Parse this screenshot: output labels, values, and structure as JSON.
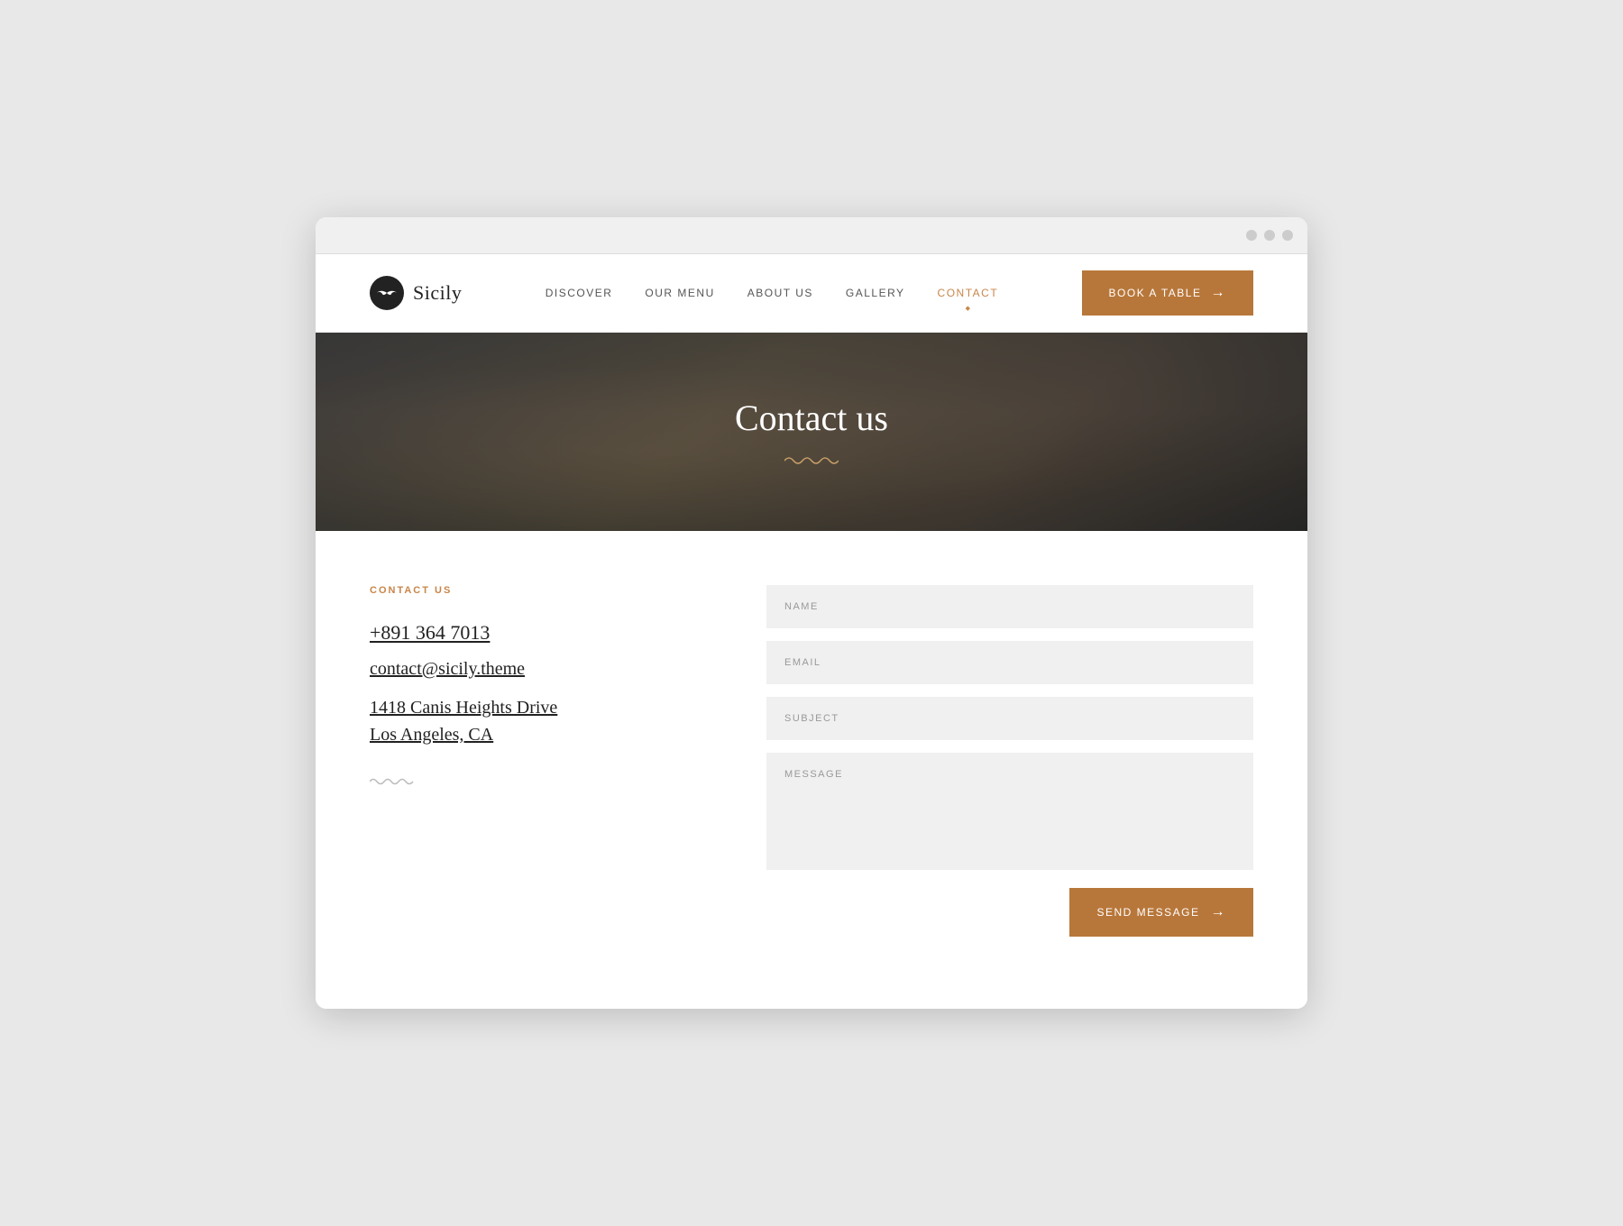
{
  "browser": {
    "dots": [
      "dot1",
      "dot2",
      "dot3"
    ]
  },
  "logo": {
    "text": "Sicily",
    "icon_alt": "mustache-icon"
  },
  "nav": {
    "links": [
      {
        "label": "DISCOVER",
        "active": false
      },
      {
        "label": "OUR MENU",
        "active": false
      },
      {
        "label": "ABOUT US",
        "active": false
      },
      {
        "label": "GALLERY",
        "active": false
      },
      {
        "label": "CONTACT",
        "active": true
      }
    ],
    "book_btn": "BOOK A TABLE",
    "book_arrow": "→"
  },
  "hero": {
    "title": "Contact us",
    "wave_alt": "wave-decoration"
  },
  "contact_info": {
    "label": "CONTACT US",
    "phone": "+891 364 7013",
    "email": "contact@sicily.theme",
    "address_line1": "1418  Canis Heights Drive",
    "address_line2": "Los Angeles, CA"
  },
  "form": {
    "name_placeholder": "NAME",
    "email_placeholder": "EMAIL",
    "subject_placeholder": "SUBJECT",
    "message_placeholder": "MESSAGE",
    "send_btn": "SEND MESSAGE",
    "send_arrow": "→"
  }
}
